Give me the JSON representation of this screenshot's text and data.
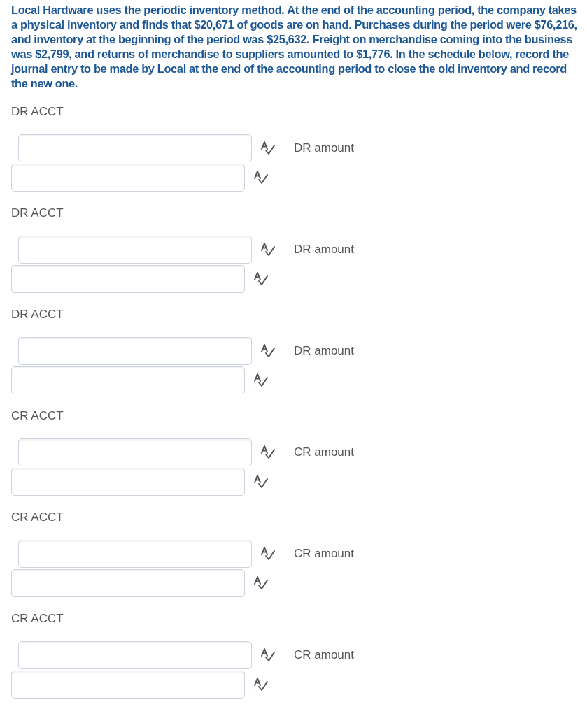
{
  "question": "Local Hardware uses the periodic inventory method. At the end of the accounting period, the company takes a physical inventory and finds that $20,671 of goods are on hand. Purchases during the period were $76,216, and inventory at the beginning of the period was $25,632. Freight on merchandise coming into the business was $2,799, and returns of merchandise to suppliers amounted to $1,776. In the schedule below, record the journal entry to be made by Local at the end of the accounting period to close the old inventory and record the new one.",
  "entries": [
    {
      "account_label": "DR ACCT",
      "amount_label": "DR amount"
    },
    {
      "account_label": "DR ACCT",
      "amount_label": "DR amount"
    },
    {
      "account_label": "DR ACCT",
      "amount_label": "DR amount"
    },
    {
      "account_label": "CR ACCT",
      "amount_label": "CR amount"
    },
    {
      "account_label": "CR ACCT",
      "amount_label": "CR amount"
    },
    {
      "account_label": "CR ACCT",
      "amount_label": "CR amount"
    }
  ]
}
